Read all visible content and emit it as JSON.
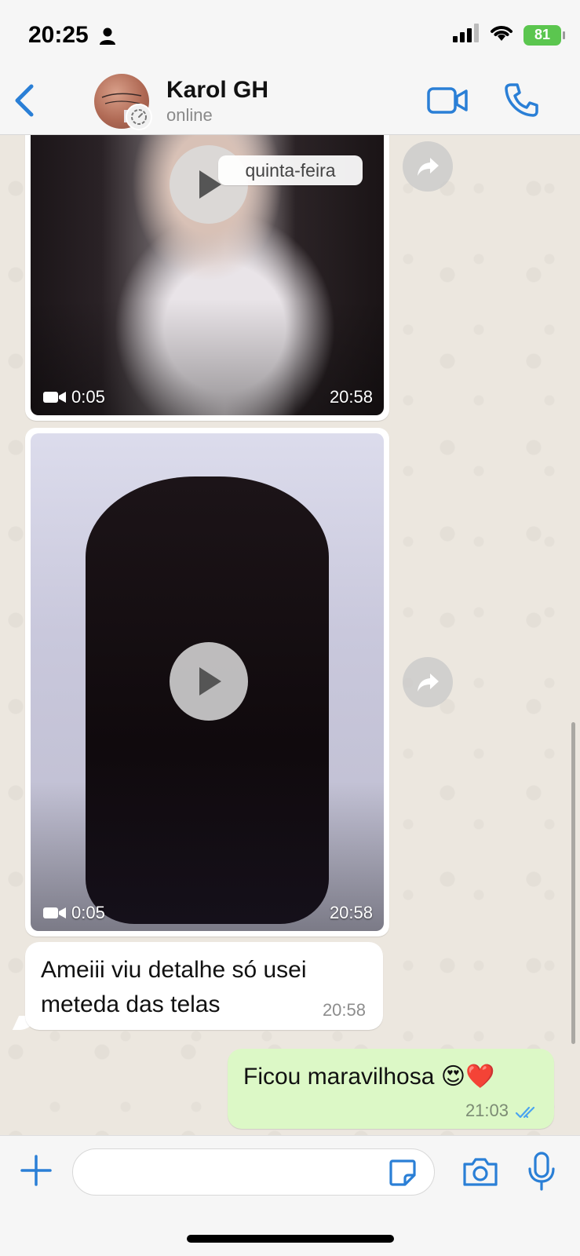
{
  "status_bar": {
    "time": "20:25",
    "battery": "81",
    "person_icon": "person-icon",
    "signal_icon": "cellular-signal-icon",
    "wifi_icon": "wifi-icon"
  },
  "header": {
    "contact_name": "Karol GH",
    "contact_status": "online",
    "back_icon": "chevron-left-icon",
    "video_call_icon": "video-camera-icon",
    "voice_call_icon": "phone-icon",
    "accent_color": "#2a7fd6"
  },
  "messages": [
    {
      "type": "video",
      "duration": "0:05",
      "time": "20:58",
      "date_label": "quinta-feira"
    },
    {
      "type": "video",
      "duration": "0:05",
      "time": "20:58"
    },
    {
      "type": "text",
      "direction": "incoming",
      "text": "Ameiii viu detalhe só usei meteda das telas",
      "time": "20:58"
    },
    {
      "type": "text",
      "direction": "outgoing",
      "text": "Ficou maravilhosa 😍❤️",
      "time": "21:03",
      "read_ticks_color": "#4aa3f0"
    }
  ],
  "composer": {
    "input_value": "",
    "placeholder": "",
    "plus_icon": "plus-icon",
    "sticker_icon": "sticker-icon",
    "camera_icon": "camera-icon",
    "mic_icon": "microphone-icon"
  },
  "colors": {
    "outgoing_bubble": "#dcf8c6",
    "incoming_bubble": "#ffffff",
    "wallpaper": "#ece7df"
  }
}
